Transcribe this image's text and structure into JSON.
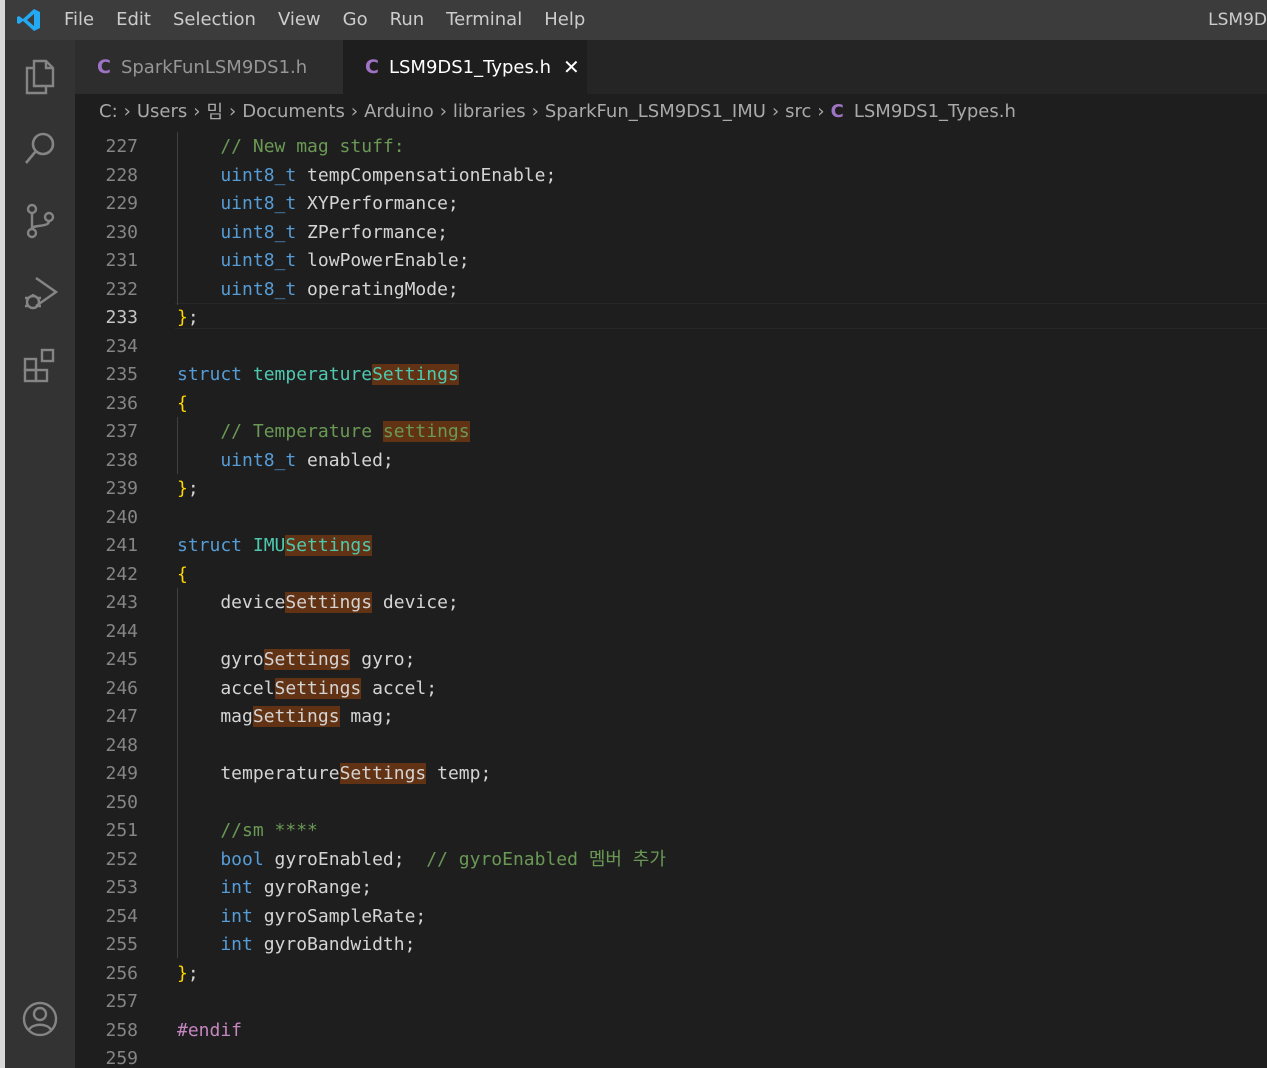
{
  "titlebar": {
    "menu": [
      "File",
      "Edit",
      "Selection",
      "View",
      "Go",
      "Run",
      "Terminal",
      "Help"
    ],
    "window_title": "LSM9D"
  },
  "tabs": [
    {
      "icon_label": "C",
      "label": "SparkFunLSM9DS1.h",
      "active": false
    },
    {
      "icon_label": "C",
      "label": "LSM9DS1_Types.h",
      "active": true,
      "close": "✕"
    }
  ],
  "breadcrumb": {
    "parts": [
      "C:",
      "Users",
      "밈",
      "Documents",
      "Arduino",
      "libraries",
      "SparkFun_LSM9DS1_IMU",
      "src"
    ],
    "file_icon": "C",
    "file": "LSM9DS1_Types.h"
  },
  "editor": {
    "current_line": "233",
    "lines": [
      {
        "n": "227",
        "t": [
          {
            "c": "cm",
            "s": "    // New mag stuff:"
          }
        ]
      },
      {
        "n": "228",
        "t": [
          {
            "c": "kw",
            "s": "    uint8_t"
          },
          {
            "s": " tempCompensationEnable;"
          }
        ]
      },
      {
        "n": "229",
        "t": [
          {
            "c": "kw",
            "s": "    uint8_t"
          },
          {
            "s": " XYPerformance;"
          }
        ]
      },
      {
        "n": "230",
        "t": [
          {
            "c": "kw",
            "s": "    uint8_t"
          },
          {
            "s": " ZPerformance;"
          }
        ]
      },
      {
        "n": "231",
        "t": [
          {
            "c": "kw",
            "s": "    uint8_t"
          },
          {
            "s": " lowPowerEnable;"
          }
        ]
      },
      {
        "n": "232",
        "t": [
          {
            "c": "kw",
            "s": "    uint8_t"
          },
          {
            "s": " operatingMode;"
          }
        ]
      },
      {
        "n": "233",
        "t": [
          {
            "c": "br",
            "s": "}"
          },
          {
            "s": ";"
          }
        ]
      },
      {
        "n": "234",
        "t": []
      },
      {
        "n": "235",
        "t": [
          {
            "c": "kw",
            "s": "struct"
          },
          {
            "s": " "
          },
          {
            "c": "ty",
            "s": "temperature"
          },
          {
            "c": "ty hl",
            "s": "Settings"
          }
        ]
      },
      {
        "n": "236",
        "t": [
          {
            "c": "br",
            "s": "{"
          }
        ]
      },
      {
        "n": "237",
        "t": [
          {
            "c": "cm",
            "s": "    // Temperature "
          },
          {
            "c": "cm hl",
            "s": "settings"
          }
        ]
      },
      {
        "n": "238",
        "t": [
          {
            "c": "kw",
            "s": "    uint8_t"
          },
          {
            "s": " enabled;"
          }
        ]
      },
      {
        "n": "239",
        "t": [
          {
            "c": "br",
            "s": "}"
          },
          {
            "s": ";"
          }
        ]
      },
      {
        "n": "240",
        "t": []
      },
      {
        "n": "241",
        "t": [
          {
            "c": "kw",
            "s": "struct"
          },
          {
            "s": " "
          },
          {
            "c": "ty",
            "s": "IMU"
          },
          {
            "c": "ty hl",
            "s": "Settings"
          }
        ]
      },
      {
        "n": "242",
        "t": [
          {
            "c": "br",
            "s": "{"
          }
        ]
      },
      {
        "n": "243",
        "t": [
          {
            "s": "    device"
          },
          {
            "c": "hl",
            "s": "Settings"
          },
          {
            "s": " device;"
          }
        ]
      },
      {
        "n": "244",
        "t": []
      },
      {
        "n": "245",
        "t": [
          {
            "s": "    gyro"
          },
          {
            "c": "hl",
            "s": "Settings"
          },
          {
            "s": " gyro;"
          }
        ]
      },
      {
        "n": "246",
        "t": [
          {
            "s": "    accel"
          },
          {
            "c": "hl",
            "s": "Settings"
          },
          {
            "s": " accel;"
          }
        ]
      },
      {
        "n": "247",
        "t": [
          {
            "s": "    mag"
          },
          {
            "c": "hl",
            "s": "Settings"
          },
          {
            "s": " mag;"
          }
        ]
      },
      {
        "n": "248",
        "t": []
      },
      {
        "n": "249",
        "t": [
          {
            "s": "    temperature"
          },
          {
            "c": "hl",
            "s": "Settings"
          },
          {
            "s": " temp;"
          }
        ]
      },
      {
        "n": "250",
        "t": []
      },
      {
        "n": "251",
        "t": [
          {
            "c": "cm",
            "s": "    //sm ****"
          }
        ]
      },
      {
        "n": "252",
        "t": [
          {
            "c": "kw",
            "s": "    bool"
          },
          {
            "s": " gyroEnabled;  "
          },
          {
            "c": "cm",
            "s": "// gyroEnabled 멤버 추가"
          }
        ]
      },
      {
        "n": "253",
        "t": [
          {
            "c": "kw",
            "s": "    int"
          },
          {
            "s": " gyroRange;"
          }
        ]
      },
      {
        "n": "254",
        "t": [
          {
            "c": "kw",
            "s": "    int"
          },
          {
            "s": " gyroSampleRate;"
          }
        ]
      },
      {
        "n": "255",
        "t": [
          {
            "c": "kw",
            "s": "    int"
          },
          {
            "s": " gyroBandwidth;"
          }
        ]
      },
      {
        "n": "256",
        "t": [
          {
            "c": "br",
            "s": "}"
          },
          {
            "s": ";"
          }
        ]
      },
      {
        "n": "257",
        "t": []
      },
      {
        "n": "258",
        "t": [
          {
            "c": "pp",
            "s": "#endif"
          }
        ]
      },
      {
        "n": "259",
        "t": []
      }
    ]
  },
  "activitybar": {
    "icons": [
      "explorer-icon",
      "search-icon",
      "source-control-icon",
      "run-debug-icon",
      "extensions-icon",
      "account-icon"
    ]
  }
}
